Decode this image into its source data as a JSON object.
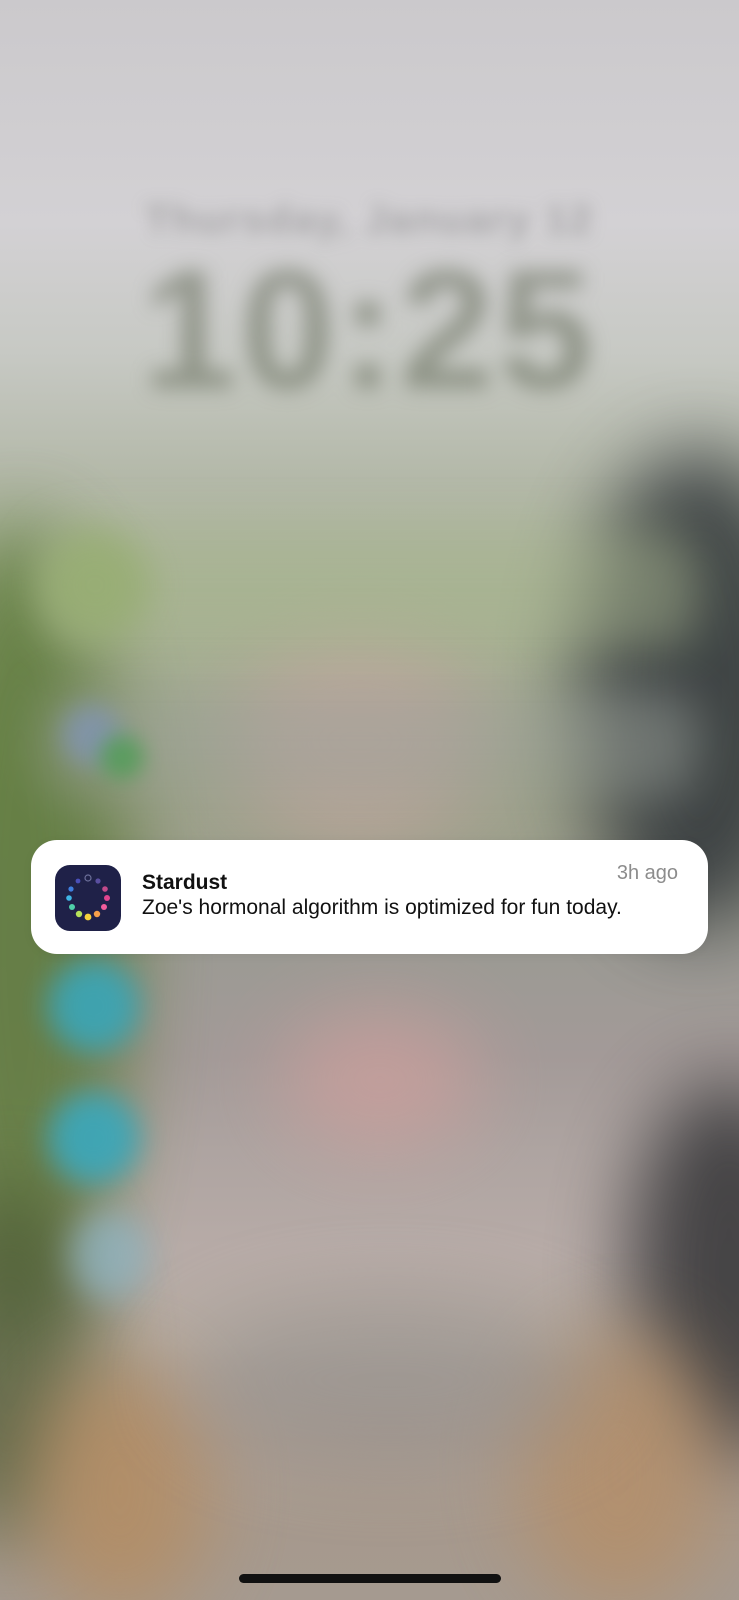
{
  "lock_screen": {
    "date": "Thursday, January 12",
    "time": "10:25"
  },
  "notification": {
    "app_name": "Stardust",
    "time": "3h ago",
    "message": "Zoe's hormonal algorithm is optimized for fun today.",
    "icon": "stardust-app-icon",
    "icon_bg": "#1f2148"
  },
  "colors": {
    "notification_bg": "#ffffff",
    "home_indicator": "#111111"
  }
}
